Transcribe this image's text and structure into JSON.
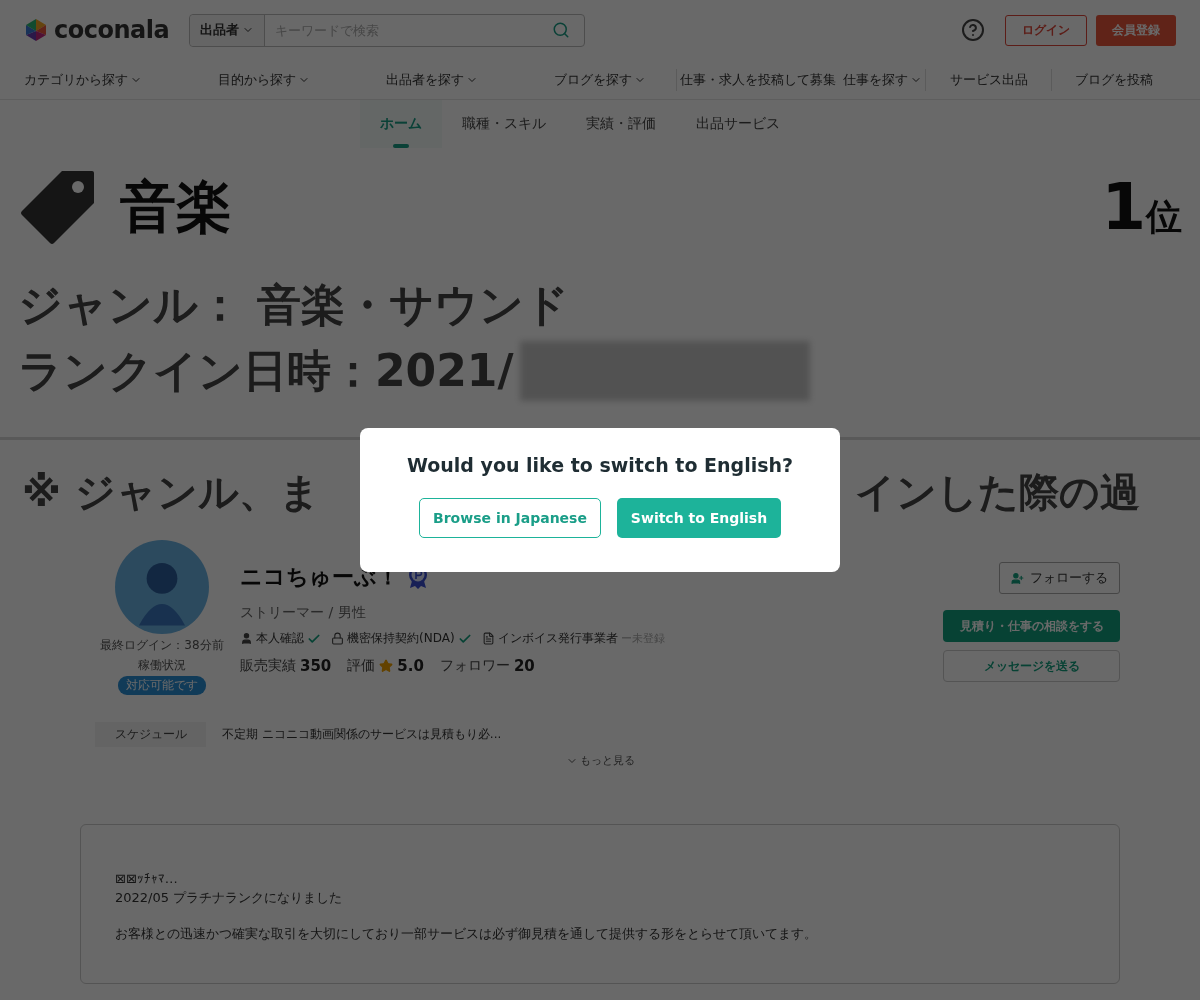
{
  "header": {
    "logo": "coconala",
    "search": {
      "scope": "出品者",
      "placeholder": "キーワードで検索"
    },
    "login": "ログイン",
    "register": "会員登録"
  },
  "nav_groups": [
    [
      {
        "label": "カテゴリから探す",
        "dropdown": true
      },
      {
        "label": "目的から探す",
        "dropdown": true
      },
      {
        "label": "出品者を探す",
        "dropdown": true
      },
      {
        "label": "ブログを探す",
        "dropdown": true
      }
    ],
    [
      {
        "label": "仕事・求人を投稿して募集",
        "dropdown": false
      },
      {
        "label": "仕事を探す",
        "dropdown": true
      }
    ],
    [
      {
        "label": "サービス出品",
        "dropdown": false
      }
    ],
    [
      {
        "label": "ブログを投稿",
        "dropdown": false
      }
    ]
  ],
  "tabs": [
    {
      "label": "ホーム",
      "selected": true
    },
    {
      "label": "職種・スキル",
      "selected": false
    },
    {
      "label": "実績・評価",
      "selected": false
    },
    {
      "label": "出品サービス",
      "selected": false
    }
  ],
  "banner": {
    "category": "音楽",
    "rank_number": "1",
    "rank_suffix": "位",
    "genre": "ジャンル： 音楽・サウンド",
    "rank_date": "ランクイン日時：2021/",
    "note_left": "※ ジャンル、ま",
    "note_right": "インした際の過"
  },
  "profile": {
    "name": "ニコちゅーぶ！",
    "subtitle": "ストリーマー / 男性",
    "last_login": "最終ログイン：38分前",
    "status_label": "稼働状況",
    "status": "対応可能です",
    "verifications": [
      {
        "kind": "person",
        "label": "本人確認",
        "checked": true
      },
      {
        "kind": "lock",
        "label": "機密保持契約(NDA)",
        "checked": true
      },
      {
        "kind": "document",
        "label": "インボイス発行事業者",
        "checked": false,
        "note": "ー未登録"
      }
    ],
    "stats": [
      {
        "label": "販売実績",
        "value": "350",
        "star": false
      },
      {
        "label": "評価",
        "value": "5.0",
        "star": true
      },
      {
        "label": "フォロワー",
        "value": "20",
        "star": false
      }
    ],
    "follow": "フォローする",
    "consult": "見積り・仕事の相談をする",
    "message": "メッセージを送る"
  },
  "schedule": {
    "label": "スケジュール",
    "text": "不定期 ニコニコ動画関係のサービスは見積もり必...",
    "more": "もっと見る"
  },
  "bio": [
    [
      "⊠⊠ｯﾁｬﾏ…",
      "2022/05 プラチナランクになりました"
    ],
    [
      "お客様との迅速かつ確実な取引を大切にしており一部サービスは必ず御見積を通して提供する形をとらせて頂いてます。"
    ]
  ],
  "modal": {
    "title": "Would you like to switch to English?",
    "secondary": "Browse in Japanese",
    "primary": "Switch to English"
  }
}
